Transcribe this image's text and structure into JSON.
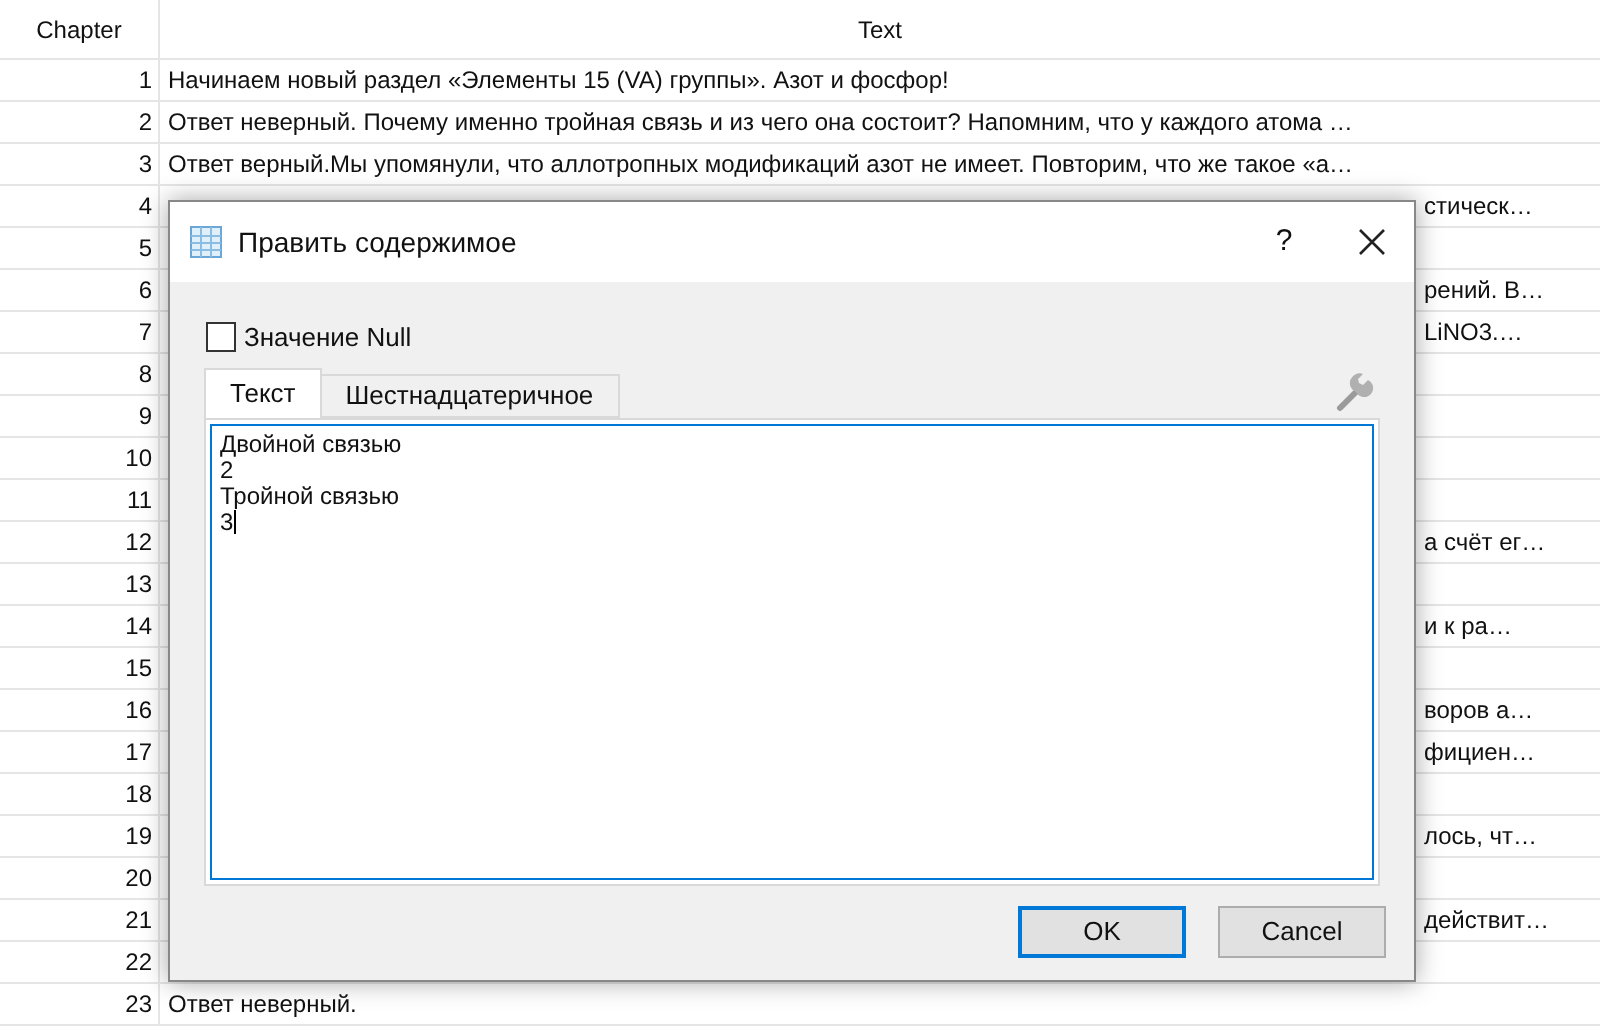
{
  "table": {
    "columns": [
      "Chapter",
      "Text"
    ],
    "rows": [
      {
        "chapter": "1",
        "text": "Начинаем новый раздел «Элементы 15 (VA) группы». Азот и фосфор!"
      },
      {
        "chapter": "2",
        "text": "Ответ неверный. Почему именно тройная связь и из чего она состоит? Напомним, что у каждого атома …"
      },
      {
        "chapter": "3",
        "text": "Ответ верный.Мы упомянули, что аллотропных модификаций азот не имеет. Повторим, что же такое «а…"
      },
      {
        "chapter": "4",
        "tail": "стическ…"
      },
      {
        "chapter": "5"
      },
      {
        "chapter": "6",
        "tail": "рений. В…"
      },
      {
        "chapter": "7",
        "tail": "LiNO3.…"
      },
      {
        "chapter": "8"
      },
      {
        "chapter": "9"
      },
      {
        "chapter": "10"
      },
      {
        "chapter": "11"
      },
      {
        "chapter": "12",
        "tail": "а счёт ег…"
      },
      {
        "chapter": "13"
      },
      {
        "chapter": "14",
        "tail": "и к ра…"
      },
      {
        "chapter": "15"
      },
      {
        "chapter": "16",
        "tail": "воров а…"
      },
      {
        "chapter": "17",
        "tail": "фициен…"
      },
      {
        "chapter": "18"
      },
      {
        "chapter": "19",
        "tail": "лось, чт…"
      },
      {
        "chapter": "20"
      },
      {
        "chapter": "21",
        "tail": "действит…"
      },
      {
        "chapter": "22"
      },
      {
        "chapter": "23",
        "text": "Ответ неверный."
      }
    ]
  },
  "dialog": {
    "title": "Править содержимое",
    "help": "?",
    "null_checkbox": {
      "label": "Значение Null",
      "checked": false
    },
    "tabs": [
      {
        "label": "Текст",
        "selected": true
      },
      {
        "label": "Шестнадцатеричное",
        "selected": false
      }
    ],
    "value": "Двойной связью\n2\nТройной связью\n3",
    "buttons": [
      "OK",
      "Cancel"
    ]
  }
}
